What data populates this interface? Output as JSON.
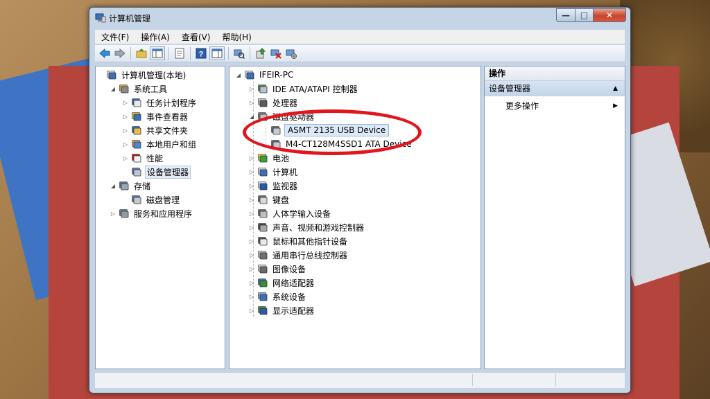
{
  "window": {
    "title": "计算机管理",
    "controls": {
      "minimize": "—",
      "maximize": "□",
      "close": "✕"
    }
  },
  "menu": [
    "文件(F)",
    "操作(A)",
    "查看(V)",
    "帮助(H)"
  ],
  "toolbar_icons": [
    "back-arrow-icon",
    "forward-arrow-icon",
    "up-folder-icon",
    "show-tree-icon",
    "properties-icon",
    "help-icon",
    "show-action-icon",
    "scan-hardware-icon",
    "update-driver-icon",
    "disable-device-icon",
    "uninstall-device-icon"
  ],
  "left_tree": [
    {
      "label": "计算机管理(本地)",
      "level": 0,
      "expander": "",
      "icon": "computer-management-icon"
    },
    {
      "label": "系统工具",
      "level": 1,
      "expander": "◢",
      "icon": "system-tools-icon"
    },
    {
      "label": "任务计划程序",
      "level": 2,
      "expander": "▷",
      "icon": "task-scheduler-icon"
    },
    {
      "label": "事件查看器",
      "level": 2,
      "expander": "▷",
      "icon": "event-viewer-icon"
    },
    {
      "label": "共享文件夹",
      "level": 2,
      "expander": "▷",
      "icon": "shared-folders-icon"
    },
    {
      "label": "本地用户和组",
      "level": 2,
      "expander": "▷",
      "icon": "local-users-icon"
    },
    {
      "label": "性能",
      "level": 2,
      "expander": "▷",
      "icon": "performance-icon"
    },
    {
      "label": "设备管理器",
      "level": 2,
      "expander": "",
      "icon": "device-manager-icon",
      "selected": true
    },
    {
      "label": "存储",
      "level": 1,
      "expander": "◢",
      "icon": "storage-icon"
    },
    {
      "label": "磁盘管理",
      "level": 2,
      "expander": "",
      "icon": "disk-management-icon"
    },
    {
      "label": "服务和应用程序",
      "level": 1,
      "expander": "▷",
      "icon": "services-apps-icon"
    }
  ],
  "device_tree": [
    {
      "label": "IFEIR-PC",
      "level": 0,
      "expander": "◢",
      "icon": "computer-icon"
    },
    {
      "label": "IDE ATA/ATAPI 控制器",
      "level": 1,
      "expander": "▷",
      "icon": "ide-controller-icon"
    },
    {
      "label": "处理器",
      "level": 1,
      "expander": "▷",
      "icon": "processor-icon"
    },
    {
      "label": "磁盘驱动器",
      "level": 1,
      "expander": "◢",
      "icon": "disk-drive-icon"
    },
    {
      "label": "ASMT 2135 USB Device",
      "level": 2,
      "expander": "",
      "icon": "hard-disk-icon",
      "selected": true
    },
    {
      "label": "M4-CT128M4SSD1 ATA Device",
      "level": 2,
      "expander": "",
      "icon": "hard-disk-icon"
    },
    {
      "label": "电池",
      "level": 1,
      "expander": "▷",
      "icon": "battery-icon"
    },
    {
      "label": "计算机",
      "level": 1,
      "expander": "▷",
      "icon": "computer-icon"
    },
    {
      "label": "监视器",
      "level": 1,
      "expander": "▷",
      "icon": "monitor-icon"
    },
    {
      "label": "键盘",
      "level": 1,
      "expander": "▷",
      "icon": "keyboard-icon"
    },
    {
      "label": "人体学输入设备",
      "level": 1,
      "expander": "▷",
      "icon": "hid-icon"
    },
    {
      "label": "声音、视频和游戏控制器",
      "level": 1,
      "expander": "▷",
      "icon": "sound-icon"
    },
    {
      "label": "鼠标和其他指针设备",
      "level": 1,
      "expander": "▷",
      "icon": "mouse-icon"
    },
    {
      "label": "通用串行总线控制器",
      "level": 1,
      "expander": "▷",
      "icon": "usb-icon"
    },
    {
      "label": "图像设备",
      "level": 1,
      "expander": "▷",
      "icon": "imaging-device-icon"
    },
    {
      "label": "网络适配器",
      "level": 1,
      "expander": "▷",
      "icon": "network-adapter-icon"
    },
    {
      "label": "系统设备",
      "level": 1,
      "expander": "▷",
      "icon": "system-devices-icon"
    },
    {
      "label": "显示适配器",
      "level": 1,
      "expander": "▷",
      "icon": "display-adapter-icon"
    }
  ],
  "actions": {
    "header": "操作",
    "section": "设备管理器",
    "section_caret": "▲",
    "item": "更多操作",
    "item_arrow": "▶"
  },
  "colors": {
    "annotation": "#e3141c",
    "window_frame": "#c6d5e6",
    "selection": "#dde9f7"
  }
}
